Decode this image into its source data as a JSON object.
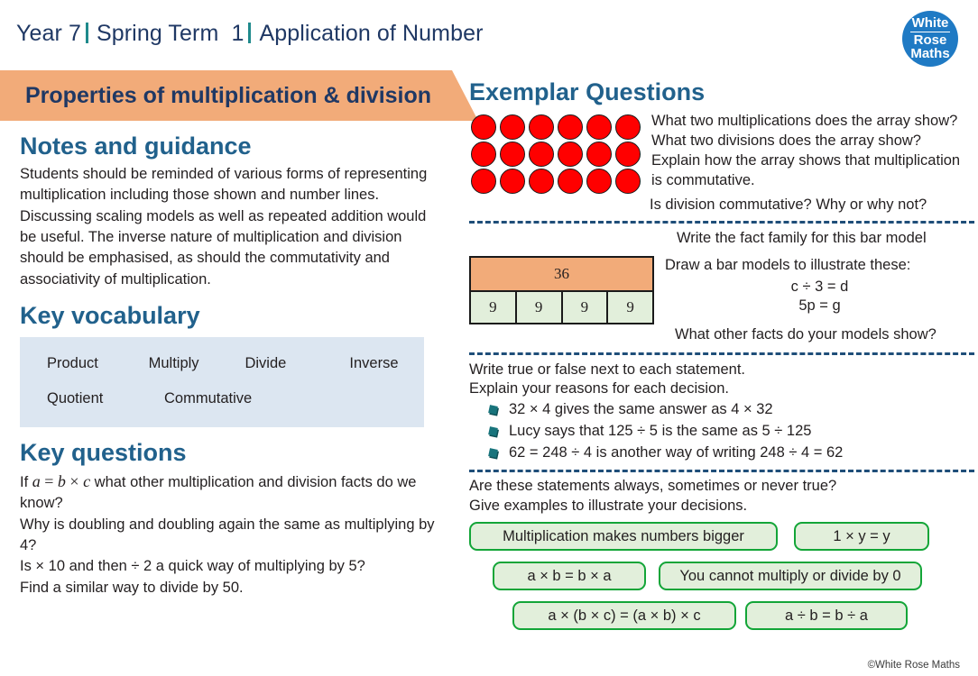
{
  "header": {
    "year": "Year 7",
    "term": "Spring Term  1",
    "topic": "Application of Number"
  },
  "logo": {
    "line1": "White",
    "line2": "Rose",
    "line3": "Maths",
    "brand_color": "#1f7ac4"
  },
  "banner": {
    "title": "Properties of multiplication & division",
    "color": "#f2ab79"
  },
  "notes": {
    "heading": "Notes and guidance",
    "text": "Students should be reminded of various forms of representing multiplication including those shown and number lines.  Discussing scaling models as well as repeated addition would be useful.  The inverse nature of multiplication and division should be emphasised, as should the commutativity and associativity of multiplication."
  },
  "vocabulary": {
    "heading": "Key vocabulary",
    "row1": [
      "Product",
      "Multiply",
      "Divide",
      "Inverse"
    ],
    "row2": [
      "Quotient",
      "Commutative"
    ],
    "box_color": "#dce6f1"
  },
  "key_questions": {
    "heading": "Key questions",
    "q1_prefix": "If ",
    "q1_math_a": "a",
    "q1_eq": " = ",
    "q1_math_b": "b",
    "q1_times": " × ",
    "q1_math_c": "c",
    "q1_suffix": " what other multiplication and division facts do we know?",
    "q2": "Why is doubling and doubling again the same as multiplying by 4?",
    "q3": "Is × 10 and then ÷ 2 a quick way of multiplying by 5?",
    "q4": "Find a similar way to divide by 50."
  },
  "exemplar": {
    "heading": "Exemplar Questions",
    "array": {
      "rows": 3,
      "cols": 6,
      "dot_color": "#ff0000",
      "questions": [
        "What two multiplications does the array show?",
        "What two divisions does the array show?",
        "Explain how the array shows that multiplication is commutative.",
        "Is division commutative?  Why or why not?"
      ]
    },
    "bar_model": {
      "whole": "36",
      "parts": [
        "9",
        "9",
        "9",
        "9"
      ],
      "whole_color": "#f2ab79",
      "part_color": "#e2efdb",
      "prompt1": "Write the fact family for this bar model",
      "prompt2": "Draw a bar models to illustrate these:",
      "expr1": "c ÷ 3 = d",
      "expr2": "5p = g",
      "prompt3": "What other facts do your models show?"
    },
    "true_false": {
      "line1": "Write true or false next to each statement.",
      "line2": "Explain your reasons for each decision.",
      "items": [
        "32 × 4 gives the same answer as 4 × 32",
        "Lucy says that 125 ÷ 5 is the same as 5 ÷ 125",
        "62 = 248 ÷ 4 is another way of writing 248 ÷ 4 = 62"
      ],
      "bullet_color": "#18747c"
    },
    "always_sometimes_never": {
      "line1": "Are these statements always, sometimes or never true?",
      "line2": "Give examples to illustrate your decisions.",
      "chips": [
        "Multiplication makes numbers bigger",
        "1 × y = y",
        "a × b = b × a",
        "You cannot multiply or divide by 0",
        "a × (b × c) = (a × b) × c",
        "a ÷ b = b ÷ a"
      ],
      "chip_border_color": "#13a538",
      "chip_fill_color": "#e2efdb"
    }
  },
  "footer": {
    "copyright": "©White Rose Maths"
  }
}
